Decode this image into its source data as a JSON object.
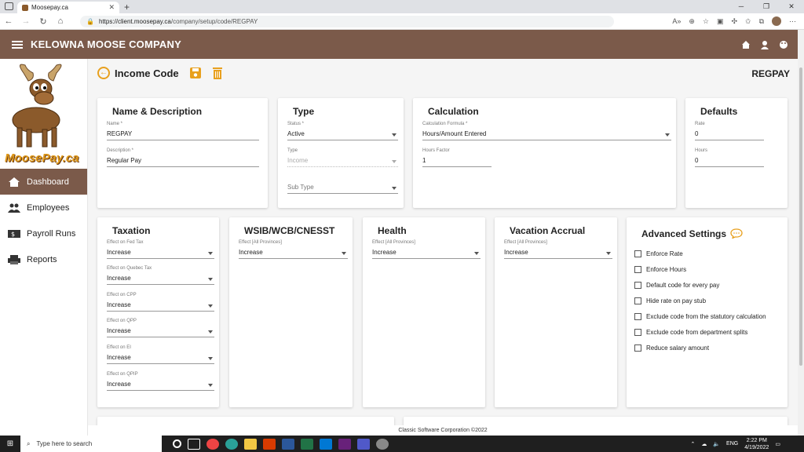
{
  "browser": {
    "tab_title": "Moosepay.ca",
    "url_host": "https://client.moosepay.ca",
    "url_path": "/company/setup/code/REGPAY"
  },
  "header": {
    "company_name": "KELOWNA MOOSE COMPANY"
  },
  "sidebar": {
    "logo_text": "MoosePay.ca",
    "items": [
      {
        "label": "Dashboard",
        "active": true
      },
      {
        "label": "Employees",
        "active": false
      },
      {
        "label": "Payroll Runs",
        "active": false
      },
      {
        "label": "Reports",
        "active": false
      }
    ]
  },
  "page": {
    "title": "Income Code",
    "code": "REGPAY"
  },
  "name_card": {
    "heading": "Name & Description",
    "name_label": "Name *",
    "name_value": "REGPAY",
    "desc_label": "Description *",
    "desc_value": "Regular Pay"
  },
  "type_card": {
    "heading": "Type",
    "status_label": "Status *",
    "status_value": "Active",
    "type_label": "Type",
    "type_value": "Income",
    "subtype_placeholder": "Sub Type"
  },
  "calc_card": {
    "heading": "Calculation",
    "formula_label": "Calculation Formula *",
    "formula_value": "Hours/Amount Entered",
    "factor_label": "Hours Factor",
    "factor_value": "1"
  },
  "defaults_card": {
    "heading": "Defaults",
    "rate_label": "Rate",
    "rate_value": "0",
    "hours_label": "Hours",
    "hours_value": "0"
  },
  "taxation_card": {
    "heading": "Taxation",
    "fields": [
      {
        "label": "Effect on Fed Tax",
        "value": "Increase"
      },
      {
        "label": "Effect on Quebec Tax",
        "value": "Increase"
      },
      {
        "label": "Effect on CPP",
        "value": "Increase"
      },
      {
        "label": "Effect on QPP",
        "value": "Increase"
      },
      {
        "label": "Effect on EI",
        "value": "Increase"
      },
      {
        "label": "Effect on QPIP",
        "value": "Increase"
      }
    ]
  },
  "wsib_card": {
    "heading": "WSIB/WCB/CNESST",
    "label": "Effect [All Provinces]",
    "value": "Increase"
  },
  "health_card": {
    "heading": "Health",
    "label": "Effect [All Provinces]",
    "value": "Increase"
  },
  "vacation_card": {
    "heading": "Vacation Accrual",
    "label": "Effect [All Provinces]",
    "value": "Increase"
  },
  "advanced_card": {
    "heading": "Advanced Settings",
    "options": [
      {
        "label": "Enforce Rate",
        "checked": false
      },
      {
        "label": "Enforce Hours",
        "checked": false
      },
      {
        "label": "Default code for every pay",
        "checked": false
      },
      {
        "label": "Hide rate on pay stub",
        "checked": false
      },
      {
        "label": "Exclude code from the statutory calculation",
        "checked": false
      },
      {
        "label": "Exclude code from department splits",
        "checked": false
      },
      {
        "label": "Reduce salary amount",
        "checked": false
      }
    ]
  },
  "footer": {
    "text": "Classic Software Corporation ©2022"
  },
  "taskbar": {
    "search_placeholder": "Type here to search",
    "lang": "ENG",
    "time": "2:22 PM",
    "date": "4/19/2022"
  },
  "colors": {
    "brand_brown": "#7b5a4a",
    "accent_orange": "#e8a01e"
  }
}
